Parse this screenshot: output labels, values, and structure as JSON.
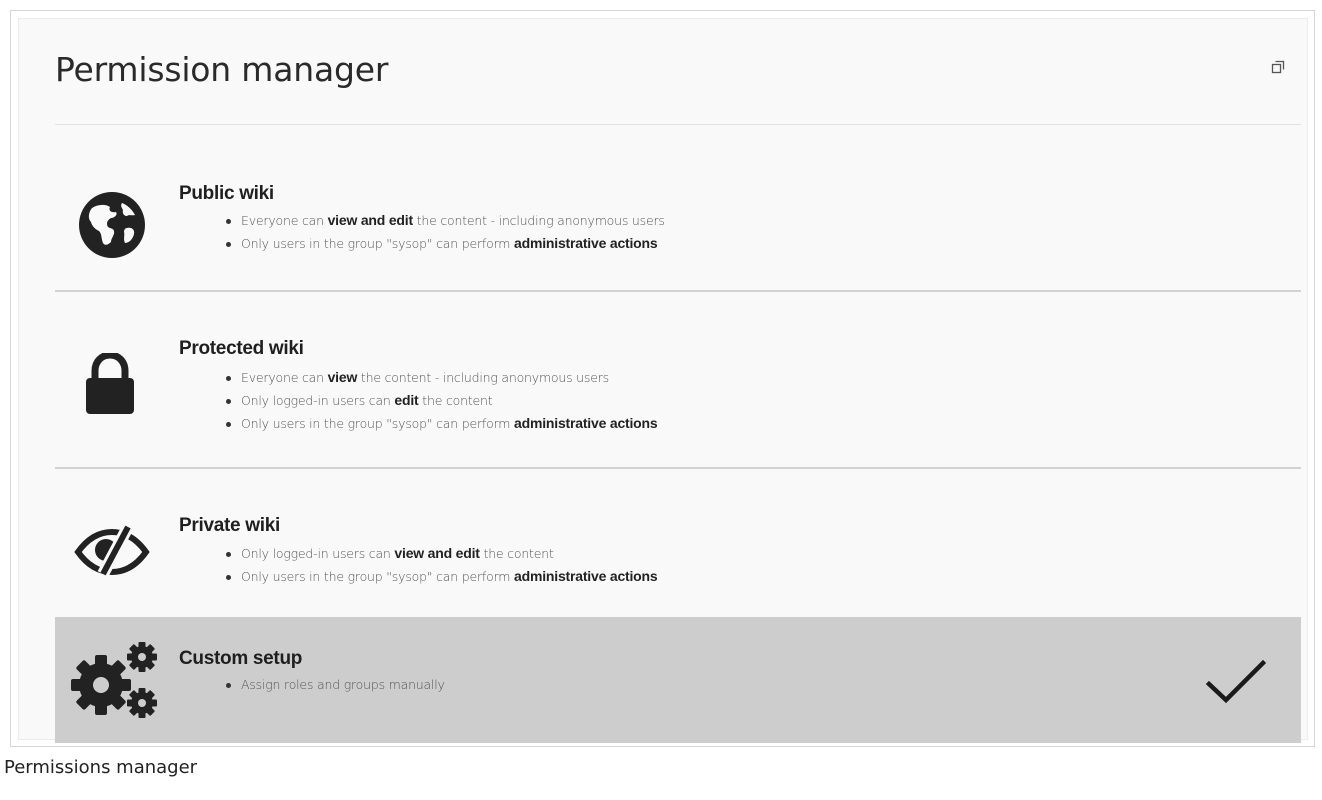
{
  "title": "Permission manager",
  "options": [
    {
      "title": "Public wiki",
      "icon": "globe-icon",
      "bullets": [
        [
          "Everyone can ",
          "view and edit",
          " the content - including anonymous users"
        ],
        [
          "Only users in the group \"sysop\" can perform ",
          "administrative actions",
          ""
        ]
      ]
    },
    {
      "title": "Protected wiki",
      "icon": "lock-icon",
      "bullets": [
        [
          "Everyone can ",
          "view",
          " the content - including anonymous users"
        ],
        [
          "Only logged-in users can ",
          "edit",
          " the content"
        ],
        [
          "Only users in the group \"sysop\" can perform ",
          "administrative actions",
          ""
        ]
      ]
    },
    {
      "title": "Private wiki",
      "icon": "eye-slash-icon",
      "bullets": [
        [
          "Only logged-in users can ",
          "view and edit",
          " the content"
        ],
        [
          "Only users in the group \"sysop\" can perform ",
          "administrative actions",
          ""
        ]
      ]
    },
    {
      "title": "Custom setup",
      "icon": "gears-icon",
      "selected": true,
      "bullets": [
        [
          "Assign roles and groups manually",
          "",
          ""
        ]
      ]
    }
  ],
  "caption": "Permissions manager",
  "colors": {
    "selected_background": "#cdcdcd",
    "icon": "#222222"
  }
}
